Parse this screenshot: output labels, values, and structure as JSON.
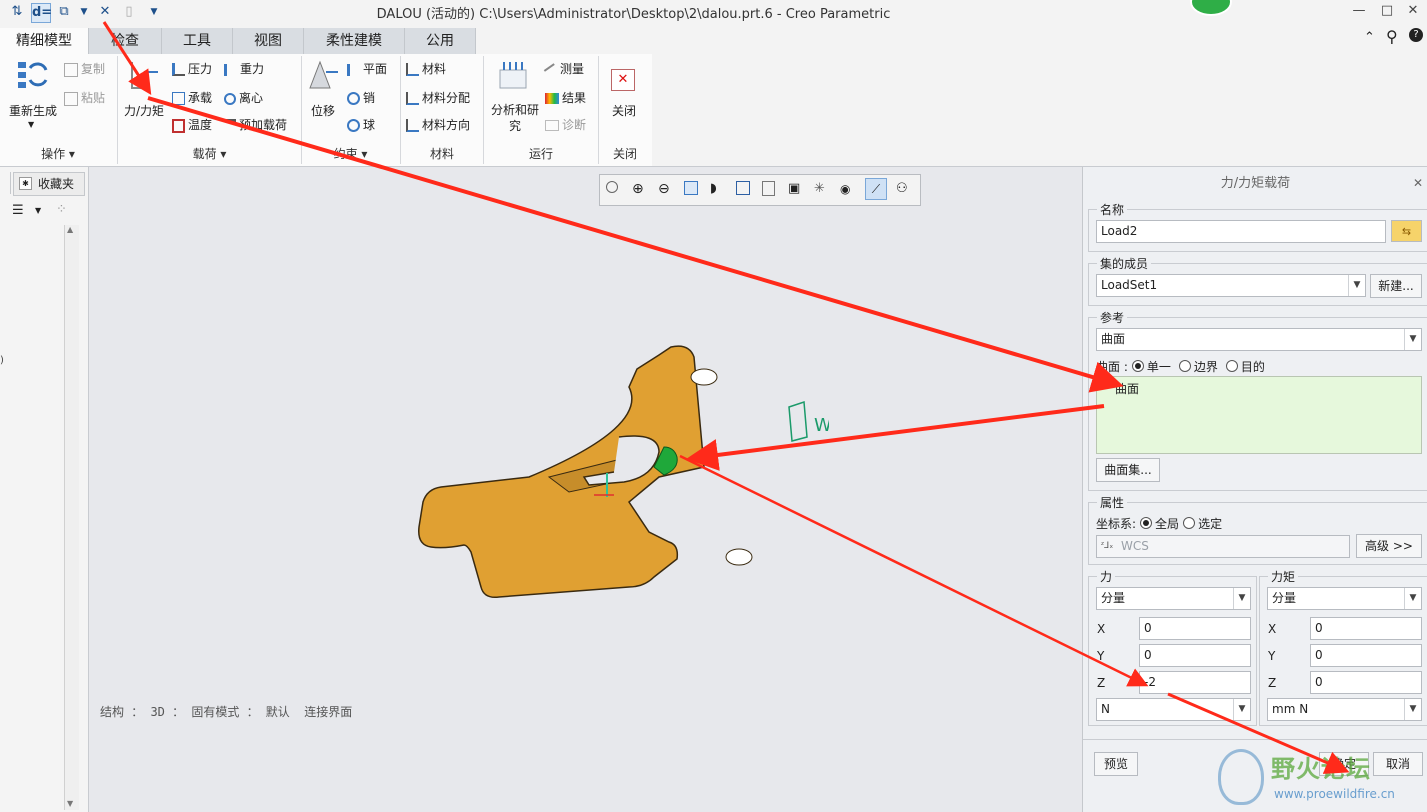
{
  "window": {
    "title": "DALOU (活动的) C:\\Users\\Administrator\\Desktop\\2\\dalou.prt.6 - Creo Parametric"
  },
  "tabs": [
    "精细模型",
    "检查",
    "工具",
    "视图",
    "柔性建模",
    "公用"
  ],
  "ribbon": {
    "ops": {
      "regen": "重新生成",
      "copy": "复制",
      "paste": "粘贴",
      "label": "操作"
    },
    "loads": {
      "force": "力/力矩",
      "pressure": "压力",
      "bearing": "承载",
      "temperature": "温度",
      "gravity": "重力",
      "centrifugal": "离心",
      "preload": "预加载荷",
      "label": "载荷"
    },
    "constraints": {
      "displacement": "位移",
      "plane": "平面",
      "pin": "销",
      "ball": "球",
      "label": "约束"
    },
    "materials": {
      "material": "材料",
      "assign": "材料分配",
      "orientation": "材料方向",
      "label": "材料"
    },
    "run": {
      "analysis": "分析和研究",
      "measure": "测量",
      "results": "结果",
      "diagnose": "诊断",
      "label": "运行"
    },
    "close": {
      "button": "关闭",
      "label": "关闭"
    }
  },
  "leftpanel": {
    "favorites": "收藏夹"
  },
  "graphics": {
    "status": "结构 ： 3D ： 固有模式 ： 默认  连接界面",
    "wcs_label": "WCS"
  },
  "dialog": {
    "title": "力/力矩载荷",
    "name_section": "名称",
    "name_value": "Load2",
    "set_section": "集的成员",
    "set_value": "LoadSet1",
    "new_button": "新建...",
    "ref_section": "参考",
    "ref_type": "曲面",
    "surface_prefix": "曲面 :",
    "radio_single": "单一",
    "radio_boundary": "边界",
    "radio_target": "目的",
    "selected_ref": "曲面",
    "surface_set_button": "曲面集...",
    "props_section": "属性",
    "csys_label": "坐标系:",
    "radio_global": "全局",
    "radio_selected": "选定",
    "csys_value": "WCS",
    "advanced_button": "高级 >>",
    "force": {
      "title": "力",
      "mode": "分量",
      "x": "0",
      "y": "0",
      "z": "-2",
      "unit": "N"
    },
    "moment": {
      "title": "力矩",
      "mode": "分量",
      "x": "0",
      "y": "0",
      "z": "0",
      "unit": "mm N"
    },
    "preview_button": "预览",
    "ok_button": "确定",
    "cancel_button": "取消"
  },
  "watermark": {
    "text": "野火论坛",
    "url": "www.proewildfire.cn"
  },
  "colors": {
    "part_orange": "#e0a032",
    "selected_surface": "#1fa83a",
    "annotation_red": "#ff2a1a",
    "ref_box_bg": "#e6f8dc"
  }
}
